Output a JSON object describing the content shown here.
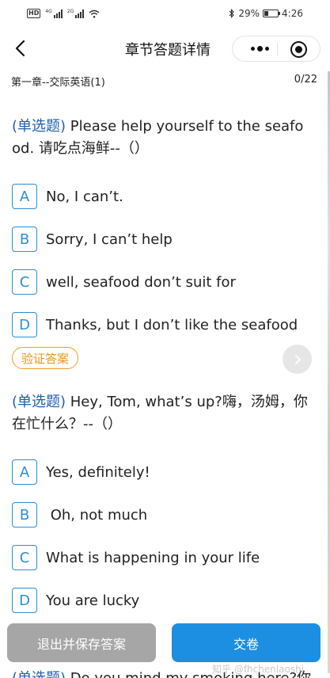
{
  "status_bar": {
    "hd_label": "HD",
    "signal1_tag": "4G",
    "signal2_tag": "2G",
    "battery_percent": "29%",
    "battery_level": 0.29,
    "time": "4:26"
  },
  "nav": {
    "title": "章节答题详情"
  },
  "chapter": {
    "name": "第一章--交际英语(1)",
    "progress": "0/22"
  },
  "questions": [
    {
      "type_label": "(单选题)",
      "text": " Please help yourself to the seafood. 请吃点海鲜--（）",
      "options": [
        {
          "letter": "A",
          "text": "No, I can’t."
        },
        {
          "letter": "B",
          "text": "Sorry, I can’t help"
        },
        {
          "letter": "C",
          "text": "well, seafood don’t suit for"
        },
        {
          "letter": "D",
          "text": "Thanks, but I don’t like the seafood"
        }
      ],
      "verify_label": "验证答案"
    },
    {
      "type_label": "(单选题)",
      "text": " Hey, Tom, what’s up?嗨，汤姆，你在忙什么？--（）",
      "options": [
        {
          "letter": "A",
          "text": "Yes, definitely!"
        },
        {
          "letter": "B",
          "text": " Oh, not much"
        },
        {
          "letter": "C",
          "text": "What is happening in your life"
        },
        {
          "letter": "D",
          "text": "You are lucky"
        }
      ]
    }
  ],
  "partial_question": {
    "type_label": "(单选题)",
    "text": " Do you mind my smoking here?你"
  },
  "buttons": {
    "exit_save": "退出并保存答案",
    "submit": "交卷"
  },
  "watermark": "知乎 @fhchenlaoshi",
  "colors": {
    "accent_blue": "#1c8fe2",
    "type_label_blue": "#1f5fb2",
    "verify_orange": "#f0a020",
    "exit_gray": "#a6a6a6"
  }
}
